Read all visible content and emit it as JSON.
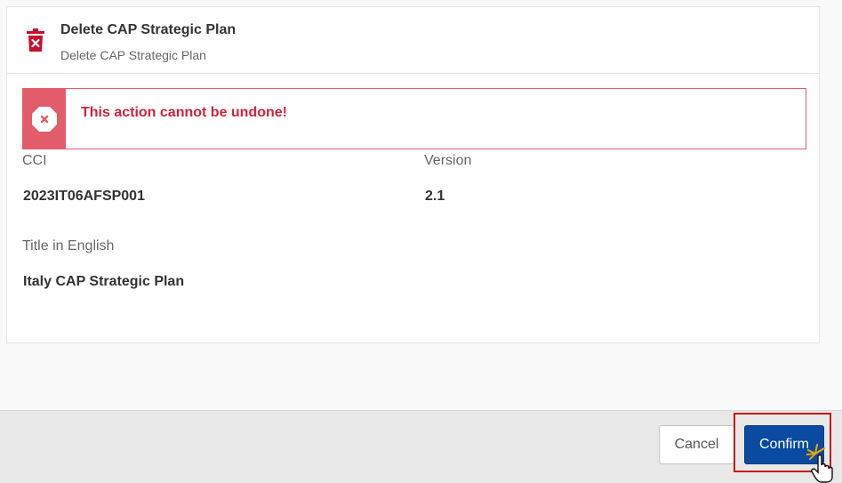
{
  "dialog": {
    "title": "Delete CAP Strategic Plan",
    "subtitle": "Delete CAP Strategic Plan",
    "icon": "trash-icon"
  },
  "alert": {
    "message": "This action cannot be undone!",
    "icon": "error-octagon-icon",
    "color": "#e25c6b",
    "text_color": "#d1233b"
  },
  "fields": {
    "cci_label": "CCI",
    "cci_value": "2023IT06AFSP001",
    "version_label": "Version",
    "version_value": "2.1",
    "title_label": "Title in English",
    "title_value": "Italy CAP Strategic Plan"
  },
  "footer": {
    "cancel_label": "Cancel",
    "confirm_label": "Confirm",
    "confirm_color": "#0a4aa1",
    "highlight_color": "#c91515"
  }
}
